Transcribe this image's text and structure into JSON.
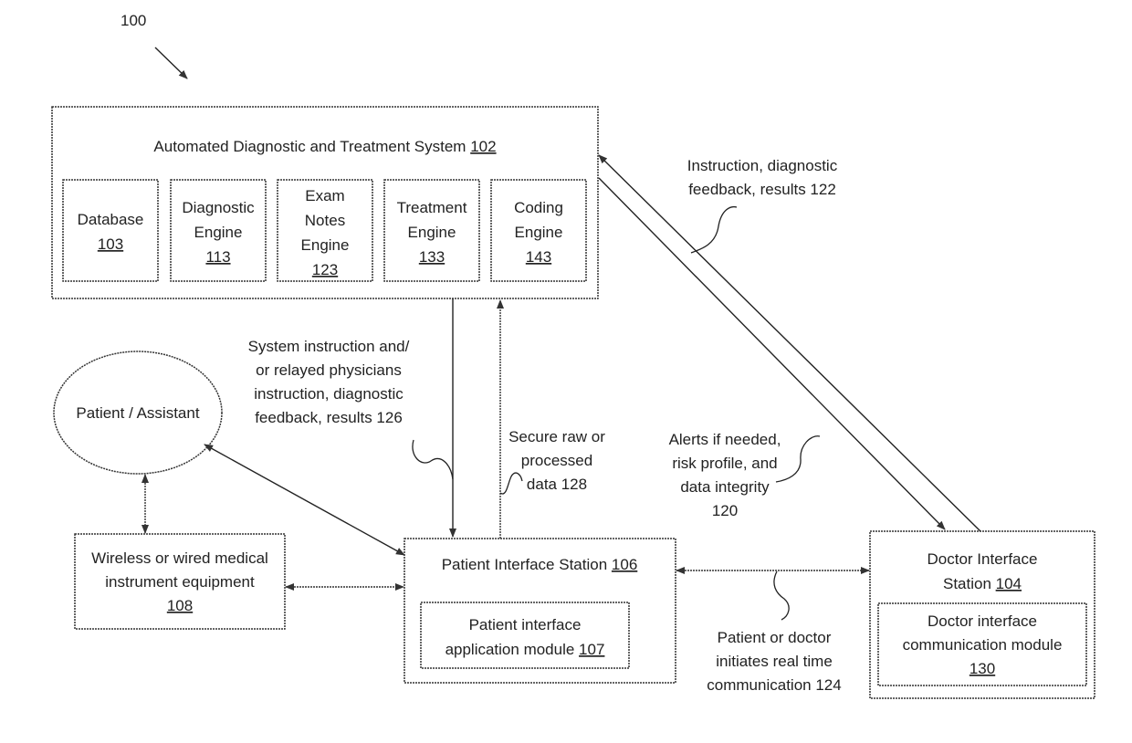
{
  "figure_ref": "100",
  "system": {
    "title": "Automated Diagnostic and Treatment System",
    "ref": "102",
    "modules": [
      {
        "lines": [
          "Database"
        ],
        "ref": "103"
      },
      {
        "lines": [
          "Diagnostic",
          "Engine"
        ],
        "ref": "113"
      },
      {
        "lines": [
          "Exam",
          "Notes",
          "Engine"
        ],
        "ref": "123"
      },
      {
        "lines": [
          "Treatment",
          "Engine"
        ],
        "ref": "133"
      },
      {
        "lines": [
          "Coding",
          "Engine"
        ],
        "ref": "143"
      }
    ]
  },
  "patient_assistant": {
    "label": "Patient / Assistant"
  },
  "instrument": {
    "lines": [
      "Wireless or wired medical",
      "instrument equipment"
    ],
    "ref": "108"
  },
  "patient_station": {
    "title": "Patient Interface Station",
    "ref": "106",
    "module": {
      "lines": [
        "Patient interface",
        "application module"
      ],
      "ref": "107"
    }
  },
  "doctor_station": {
    "title_lines": [
      "Doctor Interface",
      "Station"
    ],
    "ref": "104",
    "module": {
      "lines": [
        "Doctor interface",
        "communication module"
      ],
      "ref": "130"
    }
  },
  "flows": {
    "f126": [
      "System instruction and/",
      "or relayed physicians",
      "instruction, diagnostic",
      "feedback, results  126"
    ],
    "f128": [
      "Secure raw or",
      "processed",
      "data 128"
    ],
    "f122": [
      "Instruction, diagnostic",
      "feedback, results  122"
    ],
    "f120": [
      "Alerts if needed,",
      "risk profile, and",
      "data integrity",
      "120"
    ],
    "f124": [
      "Patient or doctor",
      "initiates real time",
      "communication 124"
    ]
  }
}
